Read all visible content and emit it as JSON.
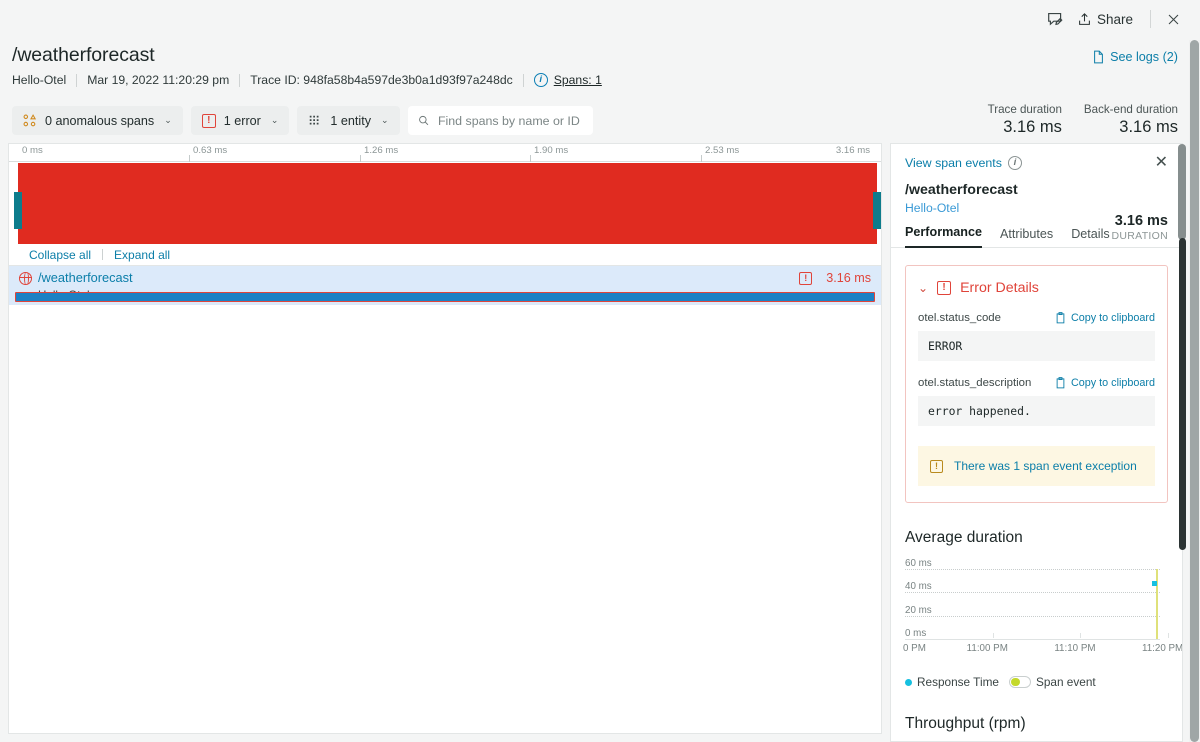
{
  "topbar": {
    "feedback_icon": "comment-edit-icon",
    "share_icon": "share-upload-icon",
    "share_label": "Share",
    "close_icon": "close-icon"
  },
  "header": {
    "title": "/weatherforecast",
    "entity": "Hello-Otel",
    "timestamp": "Mar 19, 2022 11:20:29 pm",
    "trace_id": "Trace ID: 948fa58b4a597de3b0a1d93f97a248dc",
    "spans_link": "Spans: 1",
    "see_logs": "See logs (2)"
  },
  "filters": {
    "anomalous": "0 anomalous spans",
    "errors": "1 error",
    "entities": "1 entity",
    "search_placeholder": "Find spans by name or ID",
    "search_value": "",
    "caret": "⌄"
  },
  "waterfall": {
    "ticks": [
      {
        "label": "0 ms",
        "pct": 0
      },
      {
        "label": "0.63 ms",
        "pct": 20
      },
      {
        "label": "1.26 ms",
        "pct": 40
      },
      {
        "label": "1.90 ms",
        "pct": 60
      },
      {
        "label": "2.53 ms",
        "pct": 80
      },
      {
        "label": "3.16 ms",
        "pct": 100
      }
    ],
    "collapse_all": "Collapse all",
    "expand_all": "Expand all",
    "selection_color": "#e02b20",
    "handle_color": "#0d7c8c"
  },
  "spans": [
    {
      "name": "/weatherforecast",
      "service": "Hello-Otel",
      "duration": "3.16 ms",
      "has_error": true
    }
  ],
  "duration_summary": [
    {
      "key": "Trace duration",
      "value": "3.16 ms"
    },
    {
      "key": "Back-end duration",
      "value": "3.16 ms"
    }
  ],
  "detail": {
    "view_span_events": "View span events",
    "title": "/weatherforecast",
    "service": "Hello-Otel",
    "tabs": [
      {
        "label": "Performance",
        "active": true
      },
      {
        "label": "Attributes",
        "active": false
      },
      {
        "label": "Details",
        "active": false
      }
    ],
    "duration_value": "3.16 ms",
    "duration_key": "DURATION",
    "error_details": {
      "heading": "Error Details",
      "chevron": "⌄",
      "fields": [
        {
          "label": "otel.status_code",
          "value": "ERROR",
          "copy": "Copy to clipboard"
        },
        {
          "label": "otel.status_description",
          "value": "error happened.",
          "copy": "Copy to clipboard"
        }
      ],
      "exception_note": "There was 1 span event exception"
    },
    "throughput_title": "Throughput (rpm)"
  },
  "chart_data": {
    "type": "scatter",
    "title": "Average duration",
    "xlabel": "",
    "ylabel": "",
    "ylim": [
      0,
      60
    ],
    "yticks": [
      60,
      40,
      20,
      0
    ],
    "ytick_labels": [
      "60 ms",
      "40 ms",
      "20 ms",
      "0 ms"
    ],
    "xtick_labels": [
      "0 PM",
      "11:00 PM",
      "11:10 PM",
      "11:20 PM"
    ],
    "grid": true,
    "legend_position": "bottom",
    "series": [
      {
        "name": "Response Time",
        "color": "#16c0e0",
        "points": [
          {
            "x": "11:18 PM",
            "y": 48
          }
        ]
      },
      {
        "name": "Span event",
        "color": "#dfe17a",
        "markers": [
          {
            "x": "11:18 PM"
          }
        ]
      }
    ]
  }
}
